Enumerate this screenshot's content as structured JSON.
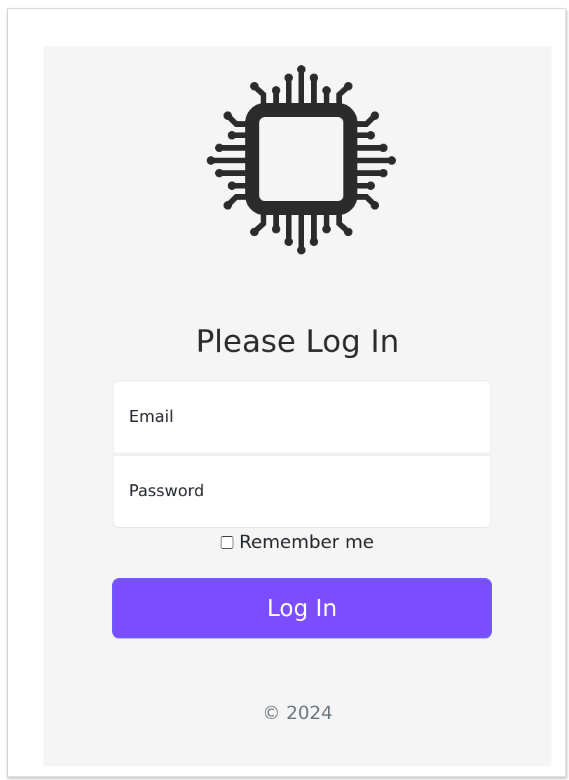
{
  "logo": {
    "icon": "cpu-chip-icon",
    "color": "#2b2b2b"
  },
  "form": {
    "title": "Please Log In",
    "email": {
      "placeholder": "Email",
      "value": ""
    },
    "password": {
      "placeholder": "Password",
      "value": ""
    },
    "remember_label": "Remember me",
    "remember_checked": false,
    "submit_label": "Log In"
  },
  "footer": {
    "text": "© 2024"
  },
  "colors": {
    "accent": "#7b4dff",
    "panel_background": "#f5f5f5",
    "muted_text": "#6c757d"
  }
}
